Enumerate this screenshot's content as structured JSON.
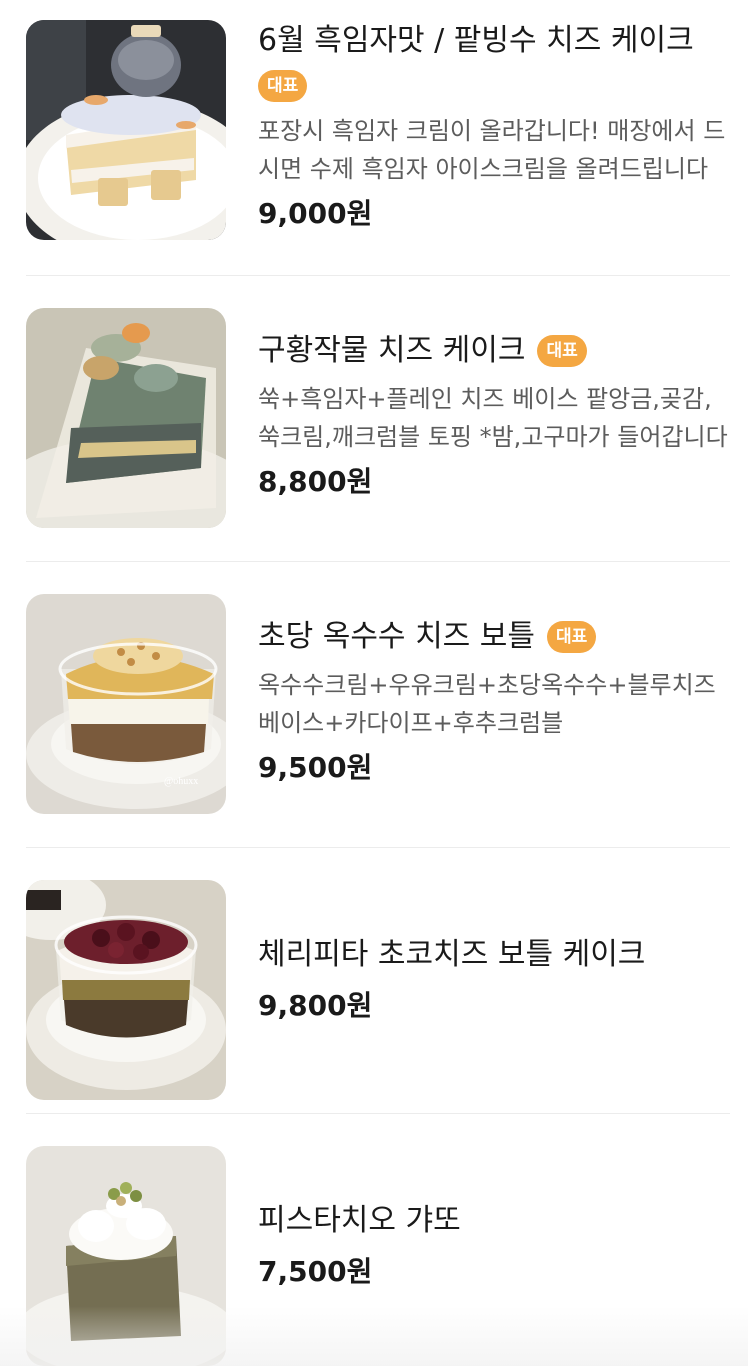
{
  "menu_items": [
    {
      "name": "6월 흑임자맛 / 팥빙수 치즈 케이크",
      "badge": "대표",
      "description": "포장시 흑임자 크림이 올라갑니다! 매장에서 드시면 수제 흑임자 아이스크림을 올려드립니다",
      "price": "9,000원"
    },
    {
      "name": "구황작물 치즈 케이크",
      "badge": "대표",
      "description": "쑥+흑임자+플레인 치즈 베이스 팥앙금,곶감,쑥크림,깨크럼블 토핑 *밤,고구마가 들어갑니다",
      "price": "8,800원"
    },
    {
      "name": "초당 옥수수 치즈 보틀",
      "badge": "대표",
      "description": "옥수수크림+우유크림+초당옥수수+블루치즈베이스+카다이프+후추크럼블",
      "price": "9,500원",
      "image_watermark": "@ohuxx"
    },
    {
      "name": "체리피타 초코치즈 보틀 케이크",
      "price": "9,800원"
    },
    {
      "name": "피스타치오 갸또",
      "price": "7,500원"
    }
  ],
  "colors": {
    "badge": "#f4a742",
    "divider": "#ececec",
    "text": "#1a1a1a",
    "description": "#5c5c5c"
  }
}
